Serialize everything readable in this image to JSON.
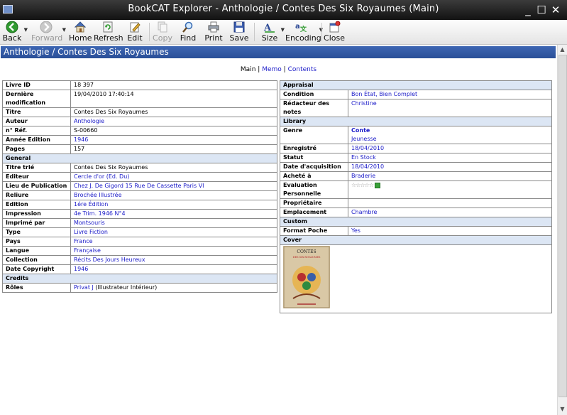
{
  "window": {
    "title": "BookCAT Explorer - Anthologie / Contes Des Six Royaumes (Main)",
    "minimize_glyph": "_",
    "maximize_glyph": "☐",
    "close_glyph": "✕"
  },
  "toolbar": {
    "back": "Back",
    "forward": "Forward",
    "home": "Home",
    "refresh": "Refresh",
    "edit": "Edit",
    "copy": "Copy",
    "find": "Find",
    "print": "Print",
    "save": "Save",
    "size": "Size",
    "encoding": "Encoding",
    "close": "Close",
    "dropdown_glyph": "▼"
  },
  "page": {
    "header": "Anthologie / Contes Des Six Royaumes",
    "tabs": {
      "main": "Main",
      "separator": "|",
      "memo": "Memo",
      "contents": "Contents"
    }
  },
  "left": {
    "rows1": [
      {
        "label": "Livre ID",
        "value": "18 397"
      },
      {
        "label": "Dernière modification",
        "value": "19/04/2010 17:40:14"
      },
      {
        "label": "Titre",
        "value": "Contes Des Six Royaumes"
      },
      {
        "label": "Auteur",
        "value": "Anthologie"
      },
      {
        "label": "n° Réf.",
        "value": "S-00660"
      },
      {
        "label": "Année Edition",
        "value": "1946"
      },
      {
        "label": "Pages",
        "value": "157"
      }
    ],
    "general": "General",
    "rows2": [
      {
        "label": "Titre trié",
        "value": "Contes Des Six Royaumes"
      },
      {
        "label": "Editeur",
        "value": "Cercle d'or (Ed. Du)"
      },
      {
        "label": "Lieu de Publication",
        "value": "Chez J. De Gigord 15 Rue De Cassette Paris VI"
      },
      {
        "label": "Reliure",
        "value": "Brochée Illustrée"
      },
      {
        "label": "Edition",
        "value": "1ére Édition"
      },
      {
        "label": "Impression",
        "value": "4e Trim. 1946 N°4"
      },
      {
        "label": "Imprimé par",
        "value": "Montsouris"
      },
      {
        "label": "Type",
        "value": "Livre Fiction"
      },
      {
        "label": "Pays",
        "value": "France"
      },
      {
        "label": "Langue",
        "value": "Française"
      },
      {
        "label": "Collection",
        "value": "Récits Des Jours Heureux"
      },
      {
        "label": "Date Copyright",
        "value": "1946"
      }
    ],
    "credits": "Credits",
    "roles": {
      "label": "Rôles",
      "value_link": "Privat J",
      "value_rest": " (Illustrateur Intérieur)"
    }
  },
  "right": {
    "appraisal": "Appraisal",
    "condition": {
      "label": "Condition",
      "value": "Bon État, Bien Complet"
    },
    "redacteur": {
      "label": "Rédacteur des notes",
      "value": "Christine"
    },
    "library": "Library",
    "genre": {
      "label": "Genre",
      "value1": "Conte",
      "value2": "Jeunesse"
    },
    "enregistre": {
      "label": "Enregistré",
      "value": "18/04/2010"
    },
    "statut": {
      "label": "Statut",
      "value": "En Stock"
    },
    "date_acq": {
      "label": "Date d'acquisition",
      "value": "18/04/2010"
    },
    "achete": {
      "label": "Acheté à",
      "value": "Braderie"
    },
    "evaluation": {
      "label": "Evaluation Personnelle",
      "stars": "☆☆☆☆☆"
    },
    "proprietaire": {
      "label": "Propriétaire",
      "value": ""
    },
    "emplacement": {
      "label": "Emplacement",
      "value": "Chambre"
    },
    "custom": "Custom",
    "format": {
      "label": "Format Poche",
      "value": "Yes"
    },
    "cover": "Cover",
    "cover_title": "CONTES",
    "cover_subtitle": "DES SIX ROYAUMES"
  },
  "colors": {
    "header_bar": "#2f58a6",
    "section_bg": "#dce6f4",
    "link": "#1a1ac8"
  }
}
